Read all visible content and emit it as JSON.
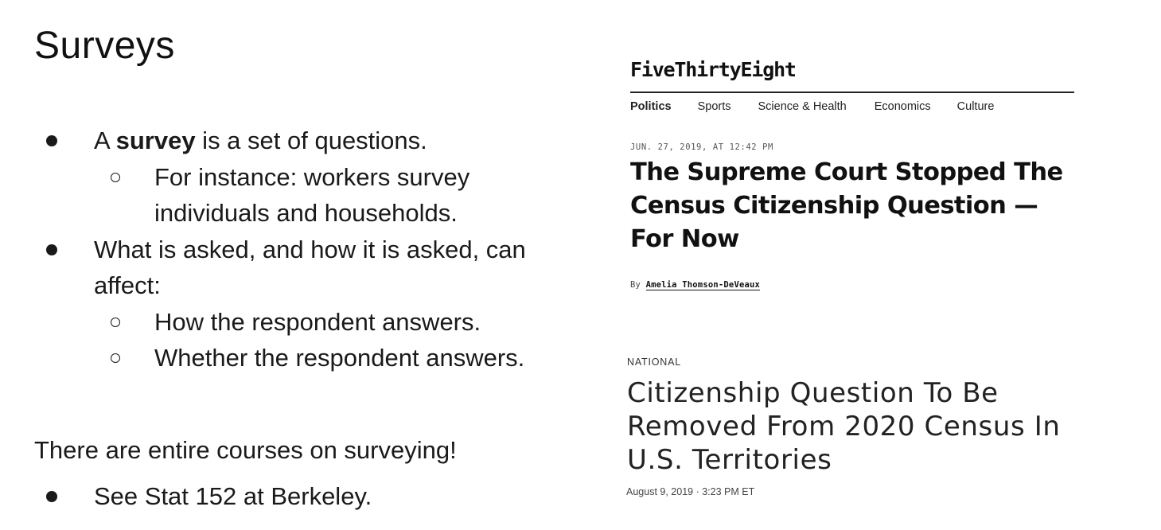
{
  "slide": {
    "title": "Surveys",
    "bullets": [
      {
        "level": 1,
        "lines": [
          {
            "pre": "A ",
            "bold": "survey",
            "post": " is a set of questions."
          }
        ]
      },
      {
        "level": 2,
        "lines": [
          {
            "text": "For instance: workers survey"
          },
          {
            "text": "individuals and households."
          }
        ]
      },
      {
        "level": 1,
        "lines": [
          {
            "text": "What is asked, and how it is asked, can"
          },
          {
            "text": "affect:"
          }
        ]
      },
      {
        "level": 2,
        "lines": [
          {
            "text": "How the respondent answers."
          }
        ]
      },
      {
        "level": 2,
        "lines": [
          {
            "text": "Whether the respondent answers."
          }
        ]
      }
    ],
    "courses_text": "There are entire courses on surveying!",
    "course_bullet": "See Stat 152 at Berkeley."
  },
  "fivethirtyeight": {
    "logo": "FiveThirtyEight",
    "nav": [
      "Politics",
      "Sports",
      "Science & Health",
      "Economics",
      "Culture"
    ],
    "date": "JUN. 27, 2019, AT 12:42 PM",
    "headline": "The Supreme Court Stopped The Census Citizenship Question — For Now",
    "byline_prefix": "By",
    "author": "Amelia Thomson-DeVeaux"
  },
  "npr": {
    "section": "NATIONAL",
    "headline": "Citizenship Question To Be Removed From 2020 Census In U.S. Territories",
    "date": "August 9, 2019 · 3:23 PM ET"
  }
}
